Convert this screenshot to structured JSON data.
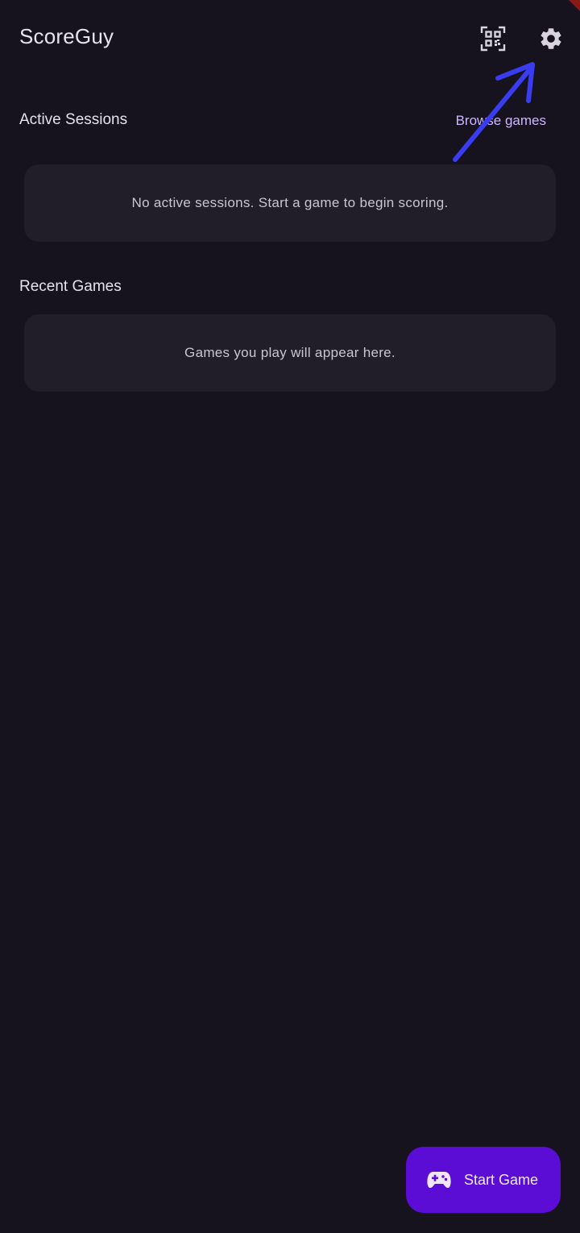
{
  "app_bar": {
    "title": "ScoreGuy",
    "qr_icon": "qr-code-scan-icon",
    "settings_icon": "gear-icon"
  },
  "active_sessions": {
    "title": "Active Sessions",
    "browse_label": "Browse games",
    "empty_text": "No active sessions. Start a game to begin scoring."
  },
  "recent_games": {
    "title": "Recent Games",
    "empty_text": "Games you play will appear here."
  },
  "fab": {
    "label": "Start Game",
    "icon": "gamepad-icon"
  },
  "colors": {
    "background": "#16131e",
    "card": "#211e29",
    "accent": "#5b0dd6",
    "link": "#cdb6ff",
    "annotation_arrow": "#3a3cf0"
  }
}
